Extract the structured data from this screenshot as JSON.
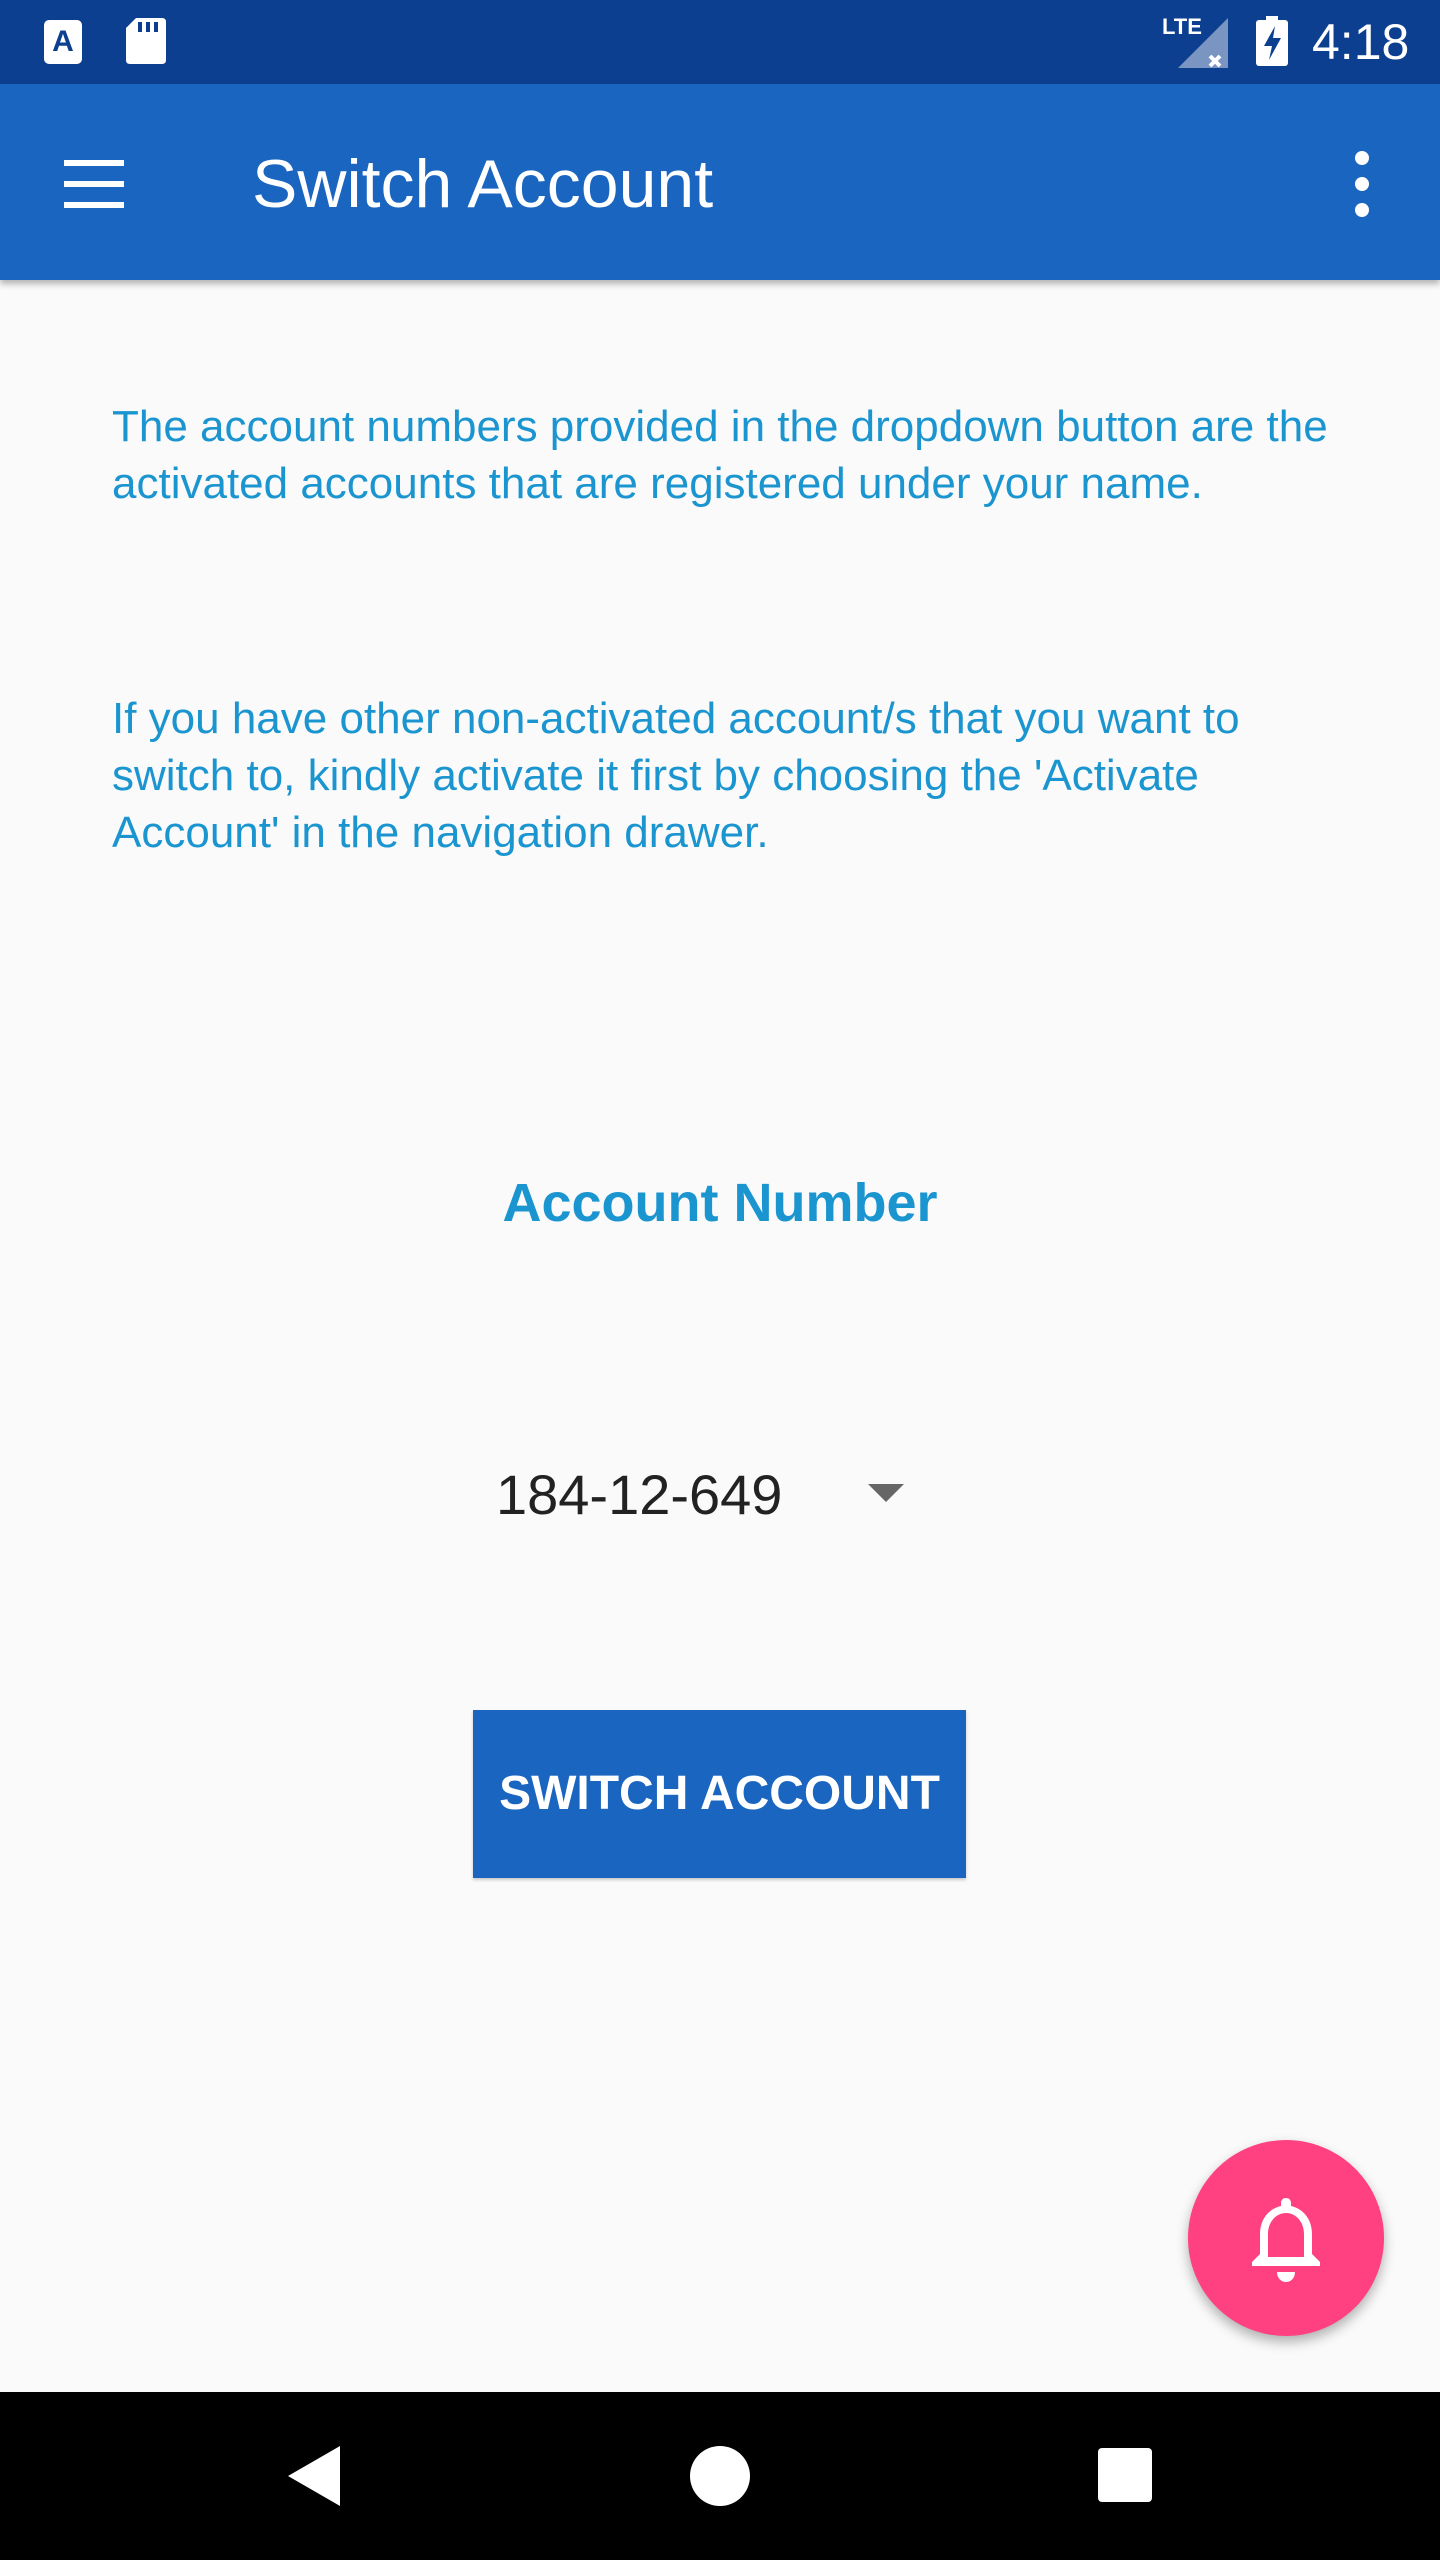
{
  "status_bar": {
    "time": "4:18",
    "network_label": "LTE",
    "left_icons": [
      "keyboard-a-icon",
      "sd-card-icon"
    ],
    "right_icons": [
      "signal-icon",
      "battery-charging-icon"
    ]
  },
  "app_bar": {
    "title": "Switch Account",
    "menu_icon": "hamburger-menu-icon",
    "overflow_icon": "more-vert-icon",
    "color": "#1a65c0"
  },
  "content": {
    "paragraph_1": "The account numbers provided in the dropdown button are the activated accounts that are registered under your name.",
    "paragraph_2": "If you have other non-activated account/s that you want to switch to, kindly activate it first by choosing the 'Activate Account' in the navigation drawer.",
    "account_label": "Account Number",
    "account_selected": "184-12-649",
    "switch_button_label": "SWITCH ACCOUNT",
    "text_color": "#1b95d0"
  },
  "fab": {
    "icon": "bell-icon",
    "color": "#ff4081"
  },
  "nav_bar": {
    "buttons": [
      "back-icon",
      "home-icon",
      "recents-icon"
    ]
  },
  "colors": {
    "status_bar": "#0d3f91",
    "background": "#fafafa"
  }
}
